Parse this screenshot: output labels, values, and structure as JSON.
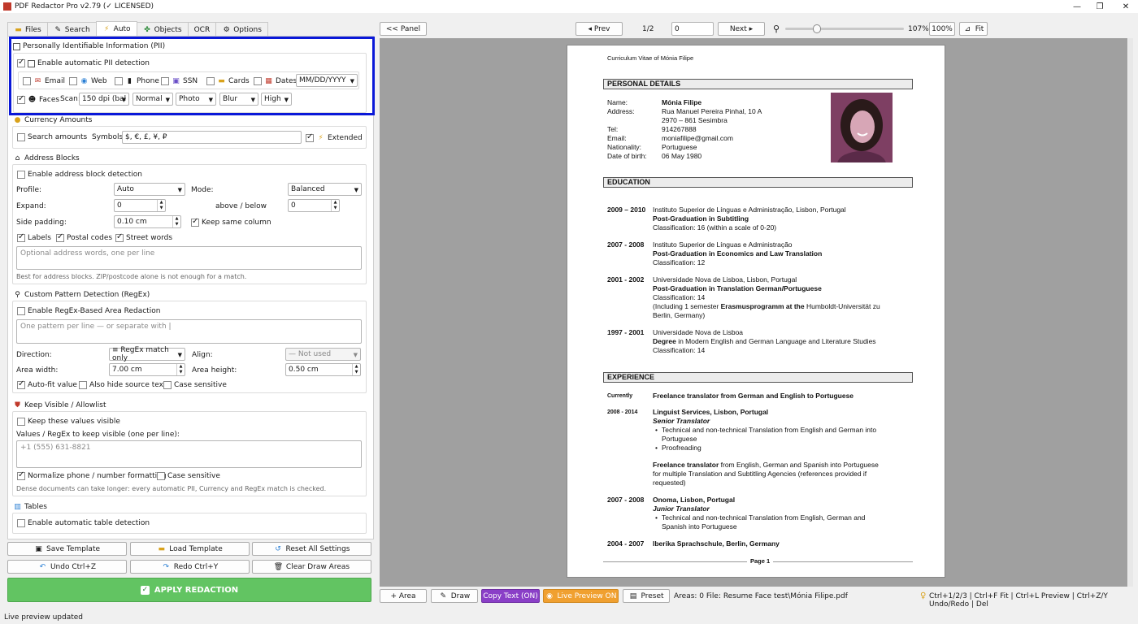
{
  "window": {
    "title": "PDF Redactor Pro v2.79 (✓ LICENSED)",
    "min": "—",
    "max": "❐",
    "close": "✕"
  },
  "tabs": [
    {
      "label": "Files"
    },
    {
      "label": "Search"
    },
    {
      "label": "Auto"
    },
    {
      "label": "Objects"
    },
    {
      "label": "OCR"
    },
    {
      "label": "Options"
    }
  ],
  "pii": {
    "title": "Personally Identifiable Information (PII)",
    "enable": "Enable automatic PII detection",
    "email": "Email",
    "web": "Web",
    "phone": "Phone",
    "ssn": "SSN",
    "cards": "Cards",
    "dates": "Dates",
    "date_format": "MM/DD/YYYY",
    "faces": "Faces",
    "scan": "Scan:",
    "dpi": "150 dpi (bal",
    "mode": "Normal",
    "type": "Photo",
    "effect": "Blur",
    "quality": "High"
  },
  "currency": {
    "title": "Currency Amounts",
    "search": "Search amounts",
    "symbols_label": "Symbols:",
    "symbols": "$, €, £, ¥, ₽",
    "extended": "Extended"
  },
  "address": {
    "title": "Address Blocks",
    "enable": "Enable address block detection",
    "profile_label": "Profile:",
    "profile": "Auto",
    "mode_label": "Mode:",
    "mode": "Balanced",
    "expand_label": "Expand:",
    "expand": "0",
    "above_label": "above / below",
    "above": "0",
    "padding_label": "Side padding:",
    "padding": "0.10 cm",
    "keep_col": "Keep same column",
    "labels": "Labels",
    "postal": "Postal codes",
    "street": "Street words",
    "placeholder": "Optional address words, one per line",
    "hint": "Best for address blocks. ZIP/postcode alone is not enough for a match."
  },
  "regex": {
    "title": "Custom Pattern Detection (RegEx)",
    "enable": "Enable RegEx-Based Area Redaction",
    "placeholder": "One pattern per line  —  or separate with |",
    "direction_label": "Direction:",
    "direction": "≡ RegEx match only",
    "align_label": "Align:",
    "align": "— Not used",
    "width_label": "Area width:",
    "width": "7.00 cm",
    "height_label": "Area height:",
    "height": "0.50 cm",
    "autofit": "Auto-fit value",
    "hide": "Also hide source text",
    "case": "Case sensitive"
  },
  "allow": {
    "title": "Keep Visible / Allowlist",
    "enable": "Keep these values visible",
    "values_label": "Values / RegEx to keep visible (one per line):",
    "placeholder": "+1 (555) 631-8821",
    "normalize": "Normalize phone / number formatting",
    "case": "Case sensitive",
    "hint": "Dense documents can take longer: every automatic PII, Currency and RegEx match is checked."
  },
  "tables": {
    "title": "Tables",
    "enable": "Enable automatic table detection"
  },
  "buttons": {
    "save_template": "Save Template",
    "load_template": "Load Template",
    "reset": "Reset All Settings",
    "undo": "Undo  Ctrl+Z",
    "redo": "Redo  Ctrl+Y",
    "clear": "Clear Draw Areas",
    "apply": "APPLY REDACTION"
  },
  "status": "Live preview updated",
  "toolbar": {
    "panel": "<< Panel",
    "prev": "◂ Prev",
    "page": "1/2",
    "page_input": "0",
    "next": "Next ▸",
    "zoom": "107%",
    "zoom100": "100%",
    "fit": "Fit"
  },
  "bottombar": {
    "area": "+ Area",
    "draw": "Draw",
    "copy": "Copy Text (ON)",
    "live": "Live Preview ON",
    "preset": "Preset",
    "info": "Areas: 0  File: Resume Face test\\Mónia Filipe.pdf",
    "shortcuts": "Ctrl+1/2/3 | Ctrl+F Fit | Ctrl+L Preview | Ctrl+Z/Y Undo/Redo | Del"
  },
  "colors": {
    "accent_highlight": "#0a18d8",
    "apply_green": "#62c462",
    "copy_purple": "#8a3fc7",
    "live_orange": "#f0a030"
  },
  "doc": {
    "header": "Curriculum Vitae of Mónia Filipe",
    "personal_title": "PERSONAL DETAILS",
    "name_label": "Name:",
    "name": "Mónia Filipe",
    "address_label": "Address:",
    "address1": "Rua Manuel Pereira Pinhal, 10 A",
    "address2": "2970 – 861 Sesimbra",
    "tel_label": "Tel:",
    "tel": "914267888",
    "email_label": "Email:",
    "email": "moniafilipe@gmail.com",
    "nat_label": "Nationality:",
    "nat": "Portuguese",
    "dob_label": "Date of birth:",
    "dob": "06 May 1980",
    "edu_title": "EDUCATION",
    "edu": [
      {
        "years": "2009 – 2010",
        "l1": "Instituto Superior de Línguas e Administração, Lisbon, Portugal",
        "l2": "Post-Graduation in Subtitling",
        "l3": "Classification: 16 (within a scale of 0-20)"
      },
      {
        "years": "2007 - 2008",
        "l1": "Instituto Superior de Línguas e Administração",
        "l2": "Post-Graduation in Economics and Law Translation",
        "l3": "Classification: 12"
      },
      {
        "years": "2001 - 2002",
        "l1": "Universidade Nova de Lisboa, Lisbon, Portugal",
        "l2": "Post-Graduation in Translation German/Portuguese",
        "l3": "Classification: 14",
        "l4a": "(Including 1 semester ",
        "l4b": "Erasmusprogramm at the",
        "l4c": " Humboldt-Universität zu",
        "l5": "Berlin, Germany)"
      },
      {
        "years": "1997 - 2001",
        "l1": "Universidade Nova de Lisboa",
        "l2a": "Degree",
        "l2b": " in Modern English and German Language and Literature Studies",
        "l3": "Classification: 14"
      }
    ],
    "exp_title": "EXPERIENCE",
    "exp": {
      "cur_label": "Currently",
      "cur": "Freelance translator from German and English to Portuguese",
      "y1": "2008 - 2014",
      "c1": "Linguist Services, Lisbon, Portugal",
      "r1": "Senior Translator",
      "b1a": "Technical and non-technical Translation from English and German into",
      "b1b": "Portuguese",
      "b2": "Proofreading",
      "fl_a": "Freelance translator",
      "fl_b": " from English, German and Spanish into Portuguese",
      "fl2": "for multiple Translation and Subtitling Agencies (references provided if",
      "fl3": "requested)",
      "y2": "2007 - 2008",
      "c2": "Onoma, Lisbon, Portugal",
      "r2": "Junior Translator",
      "b3a": "Technical and non-technical Translation from English, German and",
      "b3b": "Spanish into Portuguese",
      "y3": "2004 - 2007",
      "c3": "Iberika Sprachschule, Berlin, Germany"
    },
    "footer": "Page 1"
  }
}
